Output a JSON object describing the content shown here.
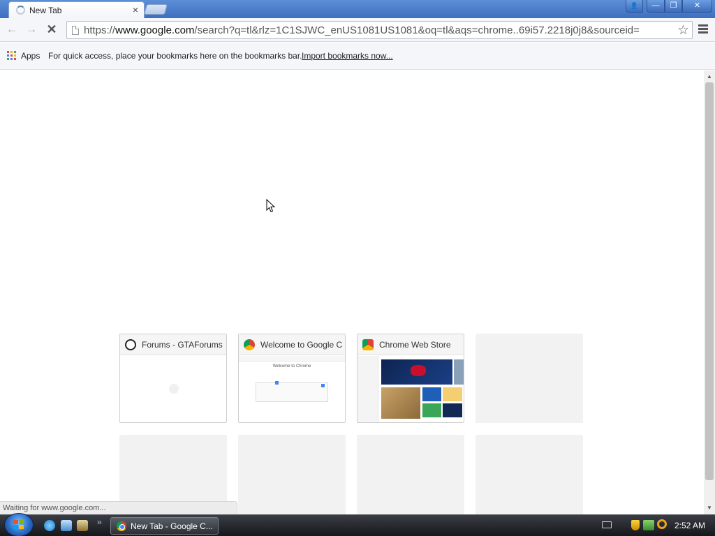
{
  "window": {
    "tab_title": "New Tab",
    "tab_close": "×",
    "min_glyph": "—",
    "max_glyph": "❐",
    "close_glyph": "✕",
    "profile_glyph": "👤"
  },
  "toolbar": {
    "back_glyph": "←",
    "forward_glyph": "→",
    "stop_glyph": "✕",
    "url_scheme": "https://",
    "url_host": "www.google.com",
    "url_rest": "/search?q=tl&rlz=1C1SJWC_enUS1081US1081&oq=tl&aqs=chrome..69i57.2218j0j8&sourceid=",
    "star_glyph": "☆"
  },
  "bookmarks_bar": {
    "apps_label": "Apps",
    "hint": "For quick access, place your bookmarks here on the bookmarks bar.",
    "import_link": "Import bookmarks now..."
  },
  "most_visited": [
    {
      "title": "Forums - GTAForums",
      "filled": true
    },
    {
      "title": "Welcome to Google Chrome",
      "filled": true,
      "thumb_heading": "Welcome to Chrome"
    },
    {
      "title": "Chrome Web Store",
      "filled": true
    },
    {
      "title": "",
      "filled": false
    },
    {
      "title": "",
      "filled": false
    },
    {
      "title": "",
      "filled": false
    },
    {
      "title": "",
      "filled": false
    },
    {
      "title": "",
      "filled": false
    }
  ],
  "scrollbar": {
    "up_glyph": "▲",
    "down_glyph": "▼"
  },
  "status_bubble": {
    "text": "Waiting for www.google.com..."
  },
  "taskbar": {
    "more_glyph": "»",
    "task_label": "New Tab - Google C...",
    "clock": "2:52 AM"
  },
  "colors": {
    "titlebar": "#3d6fc0",
    "toolbar": "#f4f6f9",
    "taskbar": "#15171b",
    "tile_empty": "#f2f2f2"
  },
  "icons": {
    "apps": "apps-grid-icon",
    "tab": "loading-spinner-icon",
    "omnibox": "page-icon",
    "bookmark": "star-icon",
    "menu": "hamburger-menu-icon",
    "tile_1": "gtaforums-favicon",
    "tile_2": "chrome-favicon",
    "tile_3": "chrome-web-store-favicon"
  }
}
